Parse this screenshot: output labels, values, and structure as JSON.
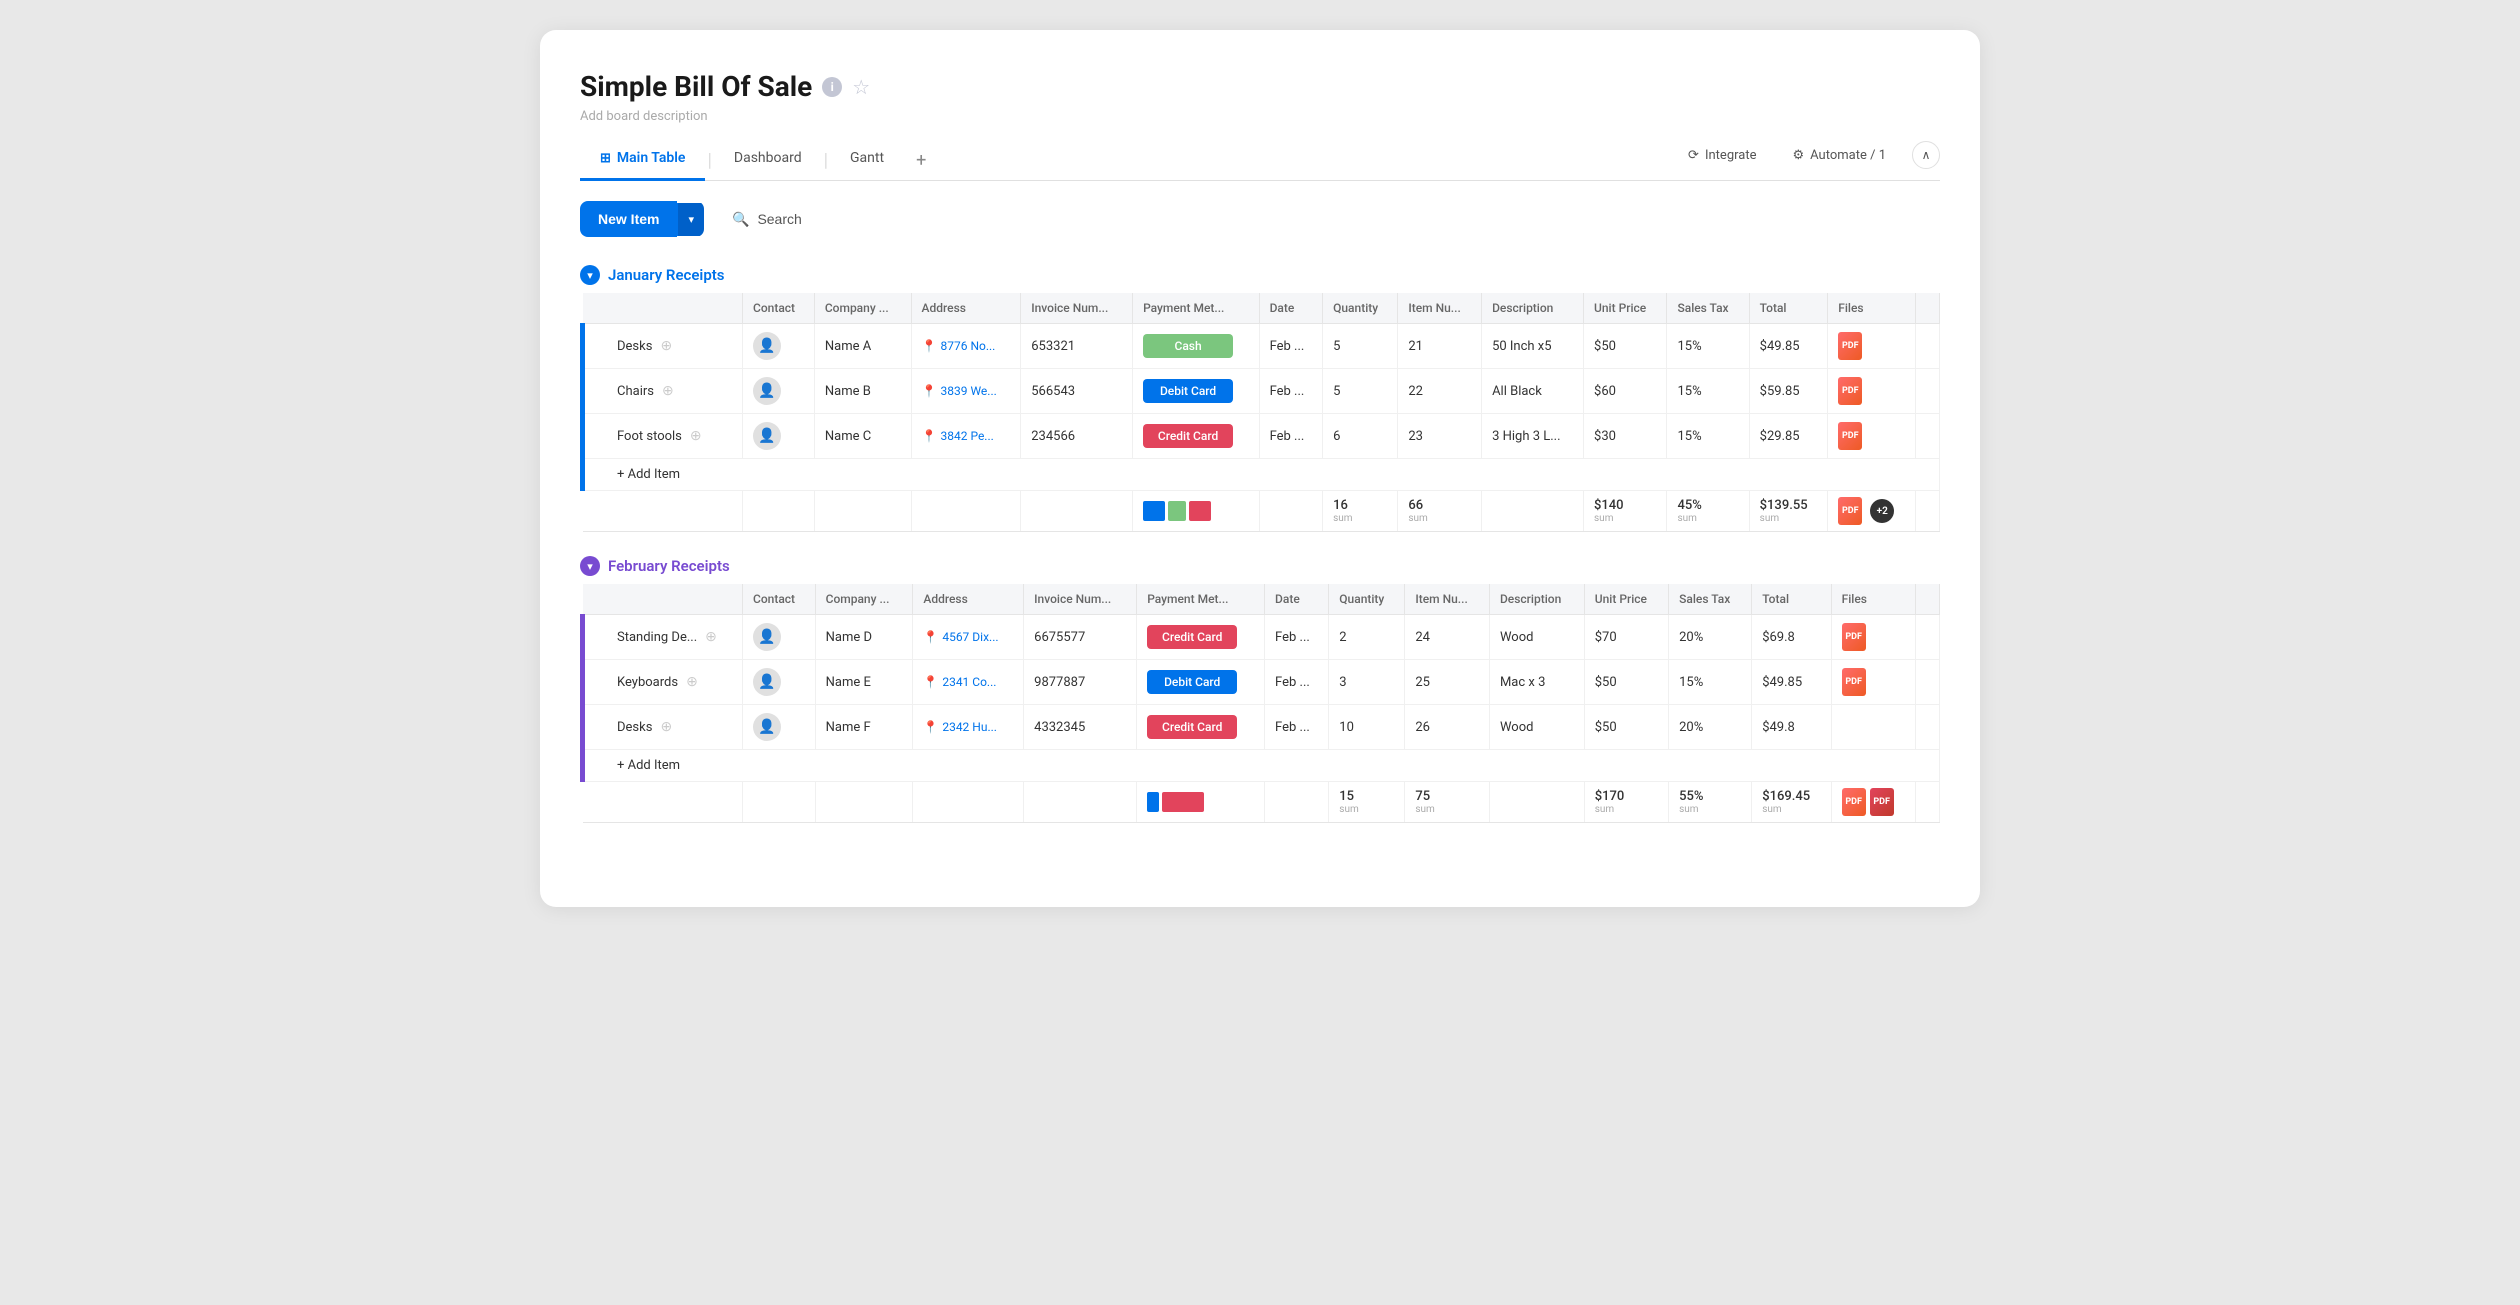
{
  "app": {
    "title": "Simple Bill Of Sale",
    "description": "Add board description"
  },
  "tabs": [
    {
      "id": "main-table",
      "label": "Main Table",
      "icon": "⊞",
      "active": true
    },
    {
      "id": "dashboard",
      "label": "Dashboard",
      "icon": "",
      "active": false
    },
    {
      "id": "gantt",
      "label": "Gantt",
      "icon": "",
      "active": false
    }
  ],
  "toolbar": {
    "integrate_label": "Integrate",
    "automate_label": "Automate / 1",
    "new_item_label": "New Item",
    "search_label": "Search"
  },
  "groups": [
    {
      "id": "january",
      "title": "January Receipts",
      "color": "#0073ea",
      "dot_color": "#0073ea",
      "columns": [
        "Contact",
        "Company ...",
        "Address",
        "Invoice Num...",
        "Payment Met...",
        "Date",
        "Quantity",
        "Item Nu...",
        "Description",
        "Unit Price",
        "Sales Tax",
        "Total",
        "Files",
        ""
      ],
      "rows": [
        {
          "name": "Desks",
          "contact": "",
          "company": "Name A",
          "address": "8776 No...",
          "invoice": "653321",
          "payment": "Cash",
          "payment_type": "cash",
          "date": "Feb ...",
          "quantity": "5",
          "item_num": "21",
          "description": "50 Inch x5",
          "unit_price": "$50",
          "sales_tax": "15%",
          "total": "$49.85",
          "has_file": true
        },
        {
          "name": "Chairs",
          "contact": "",
          "company": "Name B",
          "address": "3839 We...",
          "invoice": "566543",
          "payment": "Debit Card",
          "payment_type": "debit",
          "date": "Feb ...",
          "quantity": "5",
          "item_num": "22",
          "description": "All Black",
          "unit_price": "$60",
          "sales_tax": "15%",
          "total": "$59.85",
          "has_file": true
        },
        {
          "name": "Foot stools",
          "contact": "",
          "company": "Name C",
          "address": "3842 Pe...",
          "invoice": "234566",
          "payment": "Credit Card",
          "payment_type": "credit",
          "date": "Feb ...",
          "quantity": "6",
          "item_num": "23",
          "description": "3 High 3 L...",
          "unit_price": "$30",
          "sales_tax": "15%",
          "total": "$29.85",
          "has_file": true
        }
      ],
      "add_item_label": "+ Add Item",
      "summary": {
        "quantity_sum": "16",
        "item_num_sum": "66",
        "unit_price_sum": "$140",
        "sales_tax_sum": "45%",
        "total_sum": "$139.55",
        "sum_label": "sum",
        "files_extra": "+2"
      }
    },
    {
      "id": "february",
      "title": "February Receipts",
      "color": "#784bd1",
      "dot_color": "#784bd1",
      "columns": [
        "Contact",
        "Company ...",
        "Address",
        "Invoice Num...",
        "Payment Met...",
        "Date",
        "Quantity",
        "Item Nu...",
        "Description",
        "Unit Price",
        "Sales Tax",
        "Total",
        "Files",
        ""
      ],
      "rows": [
        {
          "name": "Standing De...",
          "contact": "",
          "company": "Name D",
          "address": "4567 Dix...",
          "invoice": "6675577",
          "payment": "Credit Card",
          "payment_type": "credit",
          "date": "Feb ...",
          "quantity": "2",
          "item_num": "24",
          "description": "Wood",
          "unit_price": "$70",
          "sales_tax": "20%",
          "total": "$69.8",
          "has_file": true
        },
        {
          "name": "Keyboards",
          "contact": "",
          "company": "Name E",
          "address": "2341 Co...",
          "invoice": "9877887",
          "payment": "Debit Card",
          "payment_type": "debit",
          "date": "Feb ...",
          "quantity": "3",
          "item_num": "25",
          "description": "Mac x 3",
          "unit_price": "$50",
          "sales_tax": "15%",
          "total": "$49.85",
          "has_file": true
        },
        {
          "name": "Desks",
          "contact": "",
          "company": "Name F",
          "address": "2342 Hu...",
          "invoice": "4332345",
          "payment": "Credit Card",
          "payment_type": "credit",
          "date": "Feb ...",
          "quantity": "10",
          "item_num": "26",
          "description": "Wood",
          "unit_price": "$50",
          "sales_tax": "20%",
          "total": "$49.8",
          "has_file": false
        }
      ],
      "add_item_label": "+ Add Item",
      "summary": {
        "quantity_sum": "15",
        "item_num_sum": "75",
        "unit_price_sum": "$170",
        "sales_tax_sum": "55%",
        "total_sum": "$169.45",
        "sum_label": "sum"
      }
    }
  ]
}
